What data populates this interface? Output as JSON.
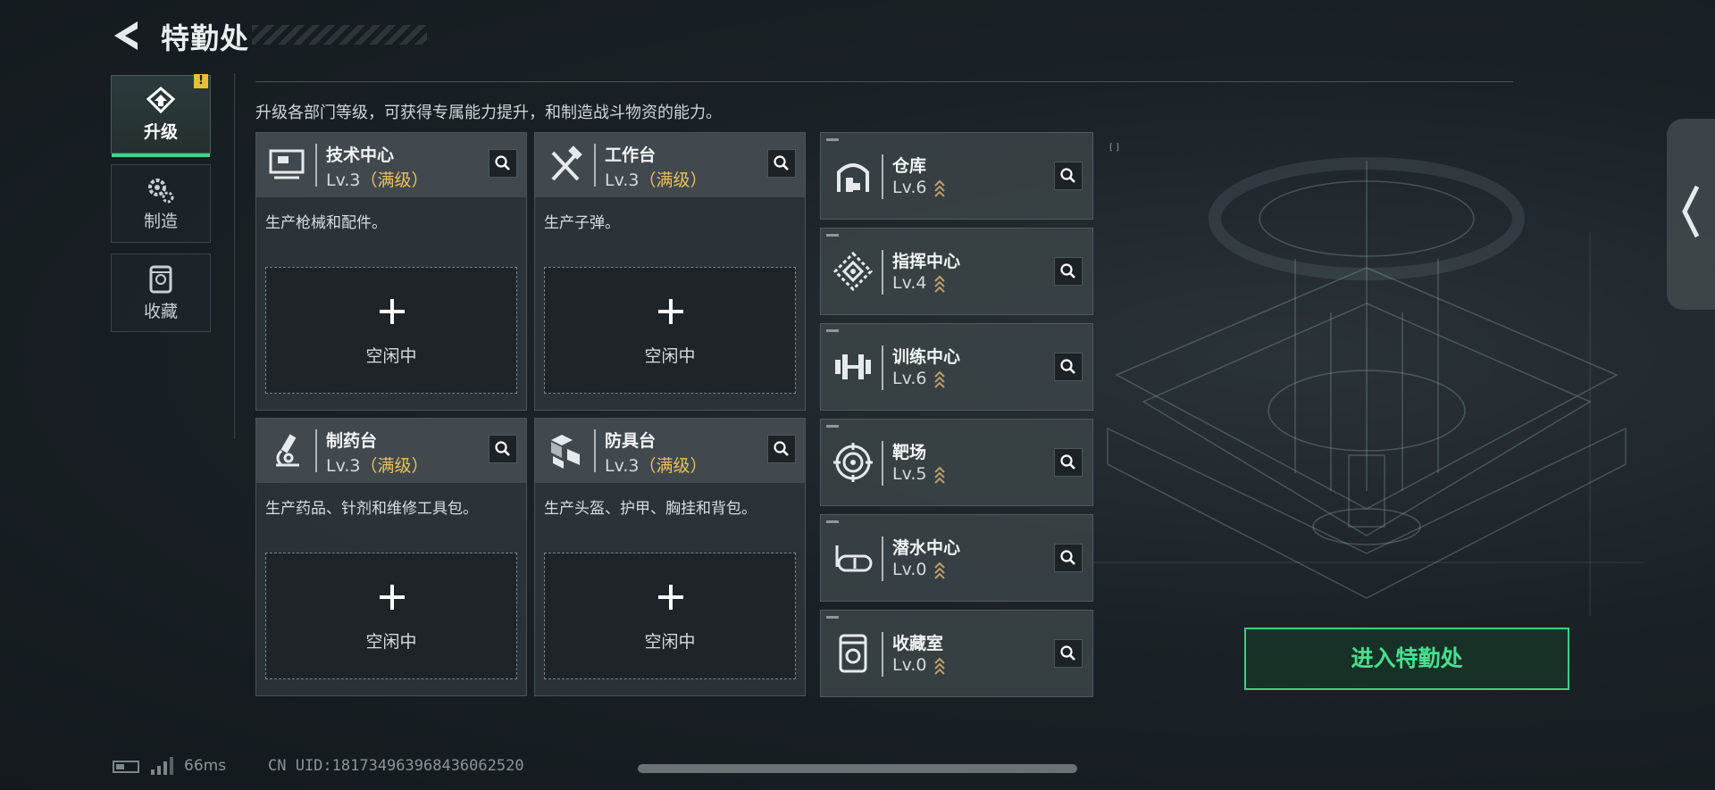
{
  "header": {
    "title": "特勤处"
  },
  "tabs": [
    {
      "label": "升级",
      "icon": "upgrade-icon",
      "active": true,
      "alert": "!"
    },
    {
      "label": "制造",
      "icon": "gears-icon",
      "active": false
    },
    {
      "label": "收藏",
      "icon": "collection-icon",
      "active": false
    }
  ],
  "description": "升级各部门等级，可获得专属能力提升，和制造战斗物资的能力。",
  "stations": [
    {
      "name": "技术中心",
      "level": "Lv.3",
      "status": "（满级）",
      "desc": "生产枪械和配件。",
      "slot": "空闲中",
      "icon": "tech-center-icon"
    },
    {
      "name": "工作台",
      "level": "Lv.3",
      "status": "（满级）",
      "desc": "生产子弹。",
      "slot": "空闲中",
      "icon": "tools-icon"
    },
    {
      "name": "制药台",
      "level": "Lv.3",
      "status": "（满级）",
      "desc": "生产药品、针剂和维修工具包。",
      "slot": "空闲中",
      "icon": "microscope-icon"
    },
    {
      "name": "防具台",
      "level": "Lv.3",
      "status": "（满级）",
      "desc": "生产头盔、护甲、胸挂和背包。",
      "slot": "空闲中",
      "icon": "armor-boxes-icon"
    }
  ],
  "facilities": [
    {
      "name": "仓库",
      "level": "Lv.6",
      "icon": "warehouse-icon"
    },
    {
      "name": "指挥中心",
      "level": "Lv.4",
      "icon": "command-icon"
    },
    {
      "name": "训练中心",
      "level": "Lv.6",
      "icon": "dumbbell-icon"
    },
    {
      "name": "靶场",
      "level": "Lv.5",
      "icon": "target-icon"
    },
    {
      "name": "潜水中心",
      "level": "Lv.0",
      "icon": "goggles-icon"
    },
    {
      "name": "收藏室",
      "level": "Lv.0",
      "icon": "collection-icon"
    }
  ],
  "enter_button": "进入特勤处",
  "status_bar": {
    "ping": "66ms",
    "uid": "CN UID:181734963968436062520"
  },
  "colors": {
    "accent_green": "#3fcf84",
    "maxed_gold": "#e8c15a",
    "alert_yellow": "#e8bf3a"
  }
}
